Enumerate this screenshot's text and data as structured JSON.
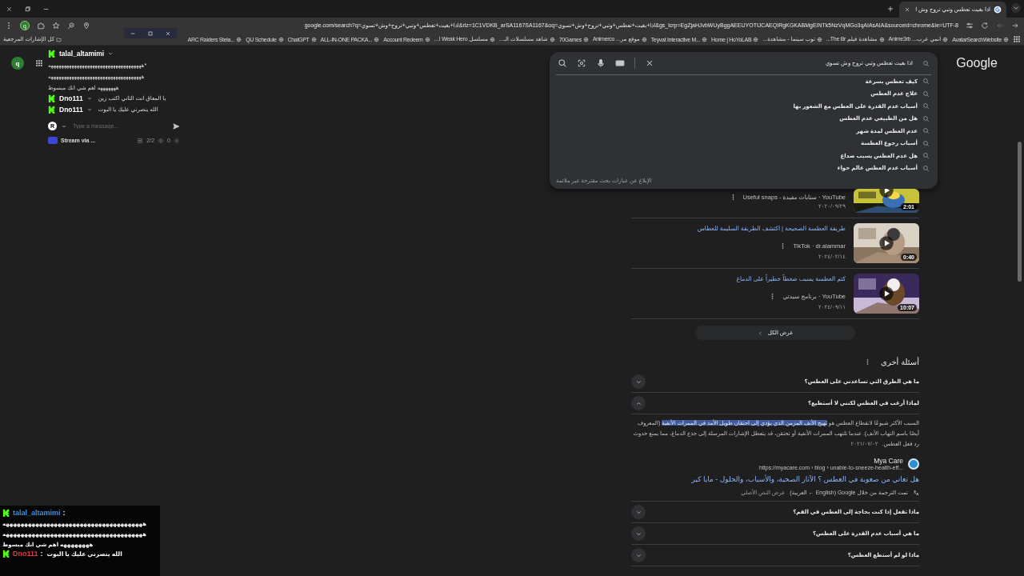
{
  "tab": {
    "title": "اذا بغيت تعطس وتبي تروح وش ا",
    "selected": true
  },
  "address": {
    "url": "google.com/search?q=اذا+بغيت+تعطس+وتبي+تروح+وش+تسوي&rlz=1C1VDKB_arSA1167SA1167&oq=اذا+بغيت+تعطس+وتبي+تروح+وش+تسوي&gs_lcrp=EgZjaHJvbWUyBggAEEUYOTIJCAEQIRgKGKABMgEINTk5NzVqMGo3qAIAsAIA&sourceid=chrome&ie=UTF-8"
  },
  "bookmarks": [
    {
      "label": "AvatarSearchWebsite"
    },
    {
      "label": "انمي عرب... Anime3rb"
    },
    {
      "label": "مشاهدة فيلم The Br..."
    },
    {
      "label": "توب سينما - مشاهدة..."
    },
    {
      "label": "Home | HoYoLAB"
    },
    {
      "label": "Teyvat Interactive M..."
    },
    {
      "label": "موقع مر... Animerco"
    },
    {
      "label": "70Games"
    },
    {
      "label": "شاهد مسلسلات الـ..."
    },
    {
      "label": "مسلسل Weak Hero ا..."
    },
    {
      "label": "Account Redeem"
    },
    {
      "label": "ALL-IN-ONE PACKA..."
    },
    {
      "label": "ChatGPT"
    },
    {
      "label": "QU Schedule"
    },
    {
      "label": "ARC Raiders Stela..."
    }
  ],
  "all_bookmarks": "كل الإشارات المرجعية",
  "profile": "q",
  "rail_profile": "q",
  "chat": {
    "messages": [
      {
        "kind": "stacked",
        "user": "talal_altamimi",
        "lines": [
          "ههههههههههههههههههههههههههههههههههههه*",
          "ههههههههههههههههههههههههههههههههههههه",
          "هههههههه اهم شي انك مبسوط"
        ]
      },
      {
        "kind": "inline",
        "user": "Dno111",
        "lines": [
          "يا المعاق انت الثاني اكتب زين"
        ]
      },
      {
        "kind": "inline",
        "user": "Dno111",
        "lines": [
          "الله ينصرني عليك يا البوت"
        ]
      }
    ],
    "avatar": "R",
    "placeholder": "Type a message...",
    "stream": "Stream via ...",
    "count": "2/2",
    "viewers": "0"
  },
  "overlay_chat": [
    {
      "kind": "stacked",
      "user": "talal_altamimi",
      "color": "#3d8fe0",
      "separator": ":",
      "lines": [
        "ههههههههههههههههههههههههههههههههههههههه",
        "ههههههههههههههههههههههههههههههههههههههه",
        "ههههههههه اهم شي انك مبسوط"
      ]
    },
    {
      "kind": "inline",
      "user": "Dno111",
      "color": "#e0383e",
      "separator": ":",
      "lines": [
        "الله ينصرني عليك يا البوت"
      ]
    }
  ],
  "google": {
    "logo": "Google",
    "search": {
      "value": "اذا بغيت تعطس وتبي تروح وش تسوي",
      "suggestions": [
        "كيف تعطس بسرعة",
        "علاج عدم العطس",
        "أسباب عدم القدرة على العطس مع الشعور بها",
        "هل من الطبيعي عدم العطس",
        "عدم العطس لمدة شهر",
        "أسباب رجوع العطسة",
        "هل عدم العطس يسبب صداع",
        "أسباب عدم العطس عالم حواء"
      ],
      "report": "الإبلاغ عن عبارات بحث مقترحة غير ملائمة"
    },
    "videos": [
      {
        "source": "YouTube · سنابات مفيدة - Useful snaps",
        "date": "٢٠٢٠/٠٩/٢٩",
        "duration": "2:01"
      },
      {
        "title": "طريقة العطسة الصحيحة | اكتشف الطريقة السليمة للعطاس",
        "source": "TikTok · dr.alammar",
        "date": "٢٠٢٤/٠٢/١٤",
        "duration": "0:40"
      },
      {
        "title": "كتم العطسة يسبب ضغطاً خطيراً على الدماغ",
        "source": "YouTube · برنامج سيدتي",
        "date": "٢٠٢٤/٠٩/١١",
        "duration": "10:07"
      }
    ],
    "show_all": "عرض الكل",
    "paa": {
      "title": "أسئلة أخرى",
      "questions": [
        {
          "text": "ما هي الطرق التي تساعدني على العطس؟",
          "expanded": false
        },
        {
          "text": "لماذا أرغب في العطس لكنني لا أستطيع؟",
          "expanded": true,
          "answer": {
            "text": "السبب الأكثر شيوعًا لانقطاع العطس هو **تهيج الأنف المزمن الذي يؤدي إلى احتقان طويل الأمد في الممرات الأنفية** (المعروف أيضًا باسم التهاب الأنف). عندما تلتهب الممرات الأنفية أو تحتقن، قد يتعطل الإشارات المرسلة إلى جذع الدماغ، مما يمنع حدوث رد فعل العطس.",
            "date": "٢٠٢١/٠٧/٠٢",
            "site": "Mya Care",
            "url": "https://myacare.com › blog › unable-to-sneeze-health-eff...",
            "link": "هل تعاني من صعوبة في العطس ؟ الآثار الصحية، والأسباب، والحلول - مايا كير",
            "translation": "تمت الترجمة من خلال Google (English ← العربية)",
            "original": "عرض النص الأصلي"
          }
        },
        {
          "text": "ماذا تفعل إذا كنت بحاجة إلى العطس في الفم؟",
          "expanded": false
        },
        {
          "text": "ما هي أسباب عدم القدرة على العطس؟",
          "expanded": false
        },
        {
          "text": "ماذا لو لم أستطع العطس؟",
          "expanded": false
        }
      ]
    }
  }
}
